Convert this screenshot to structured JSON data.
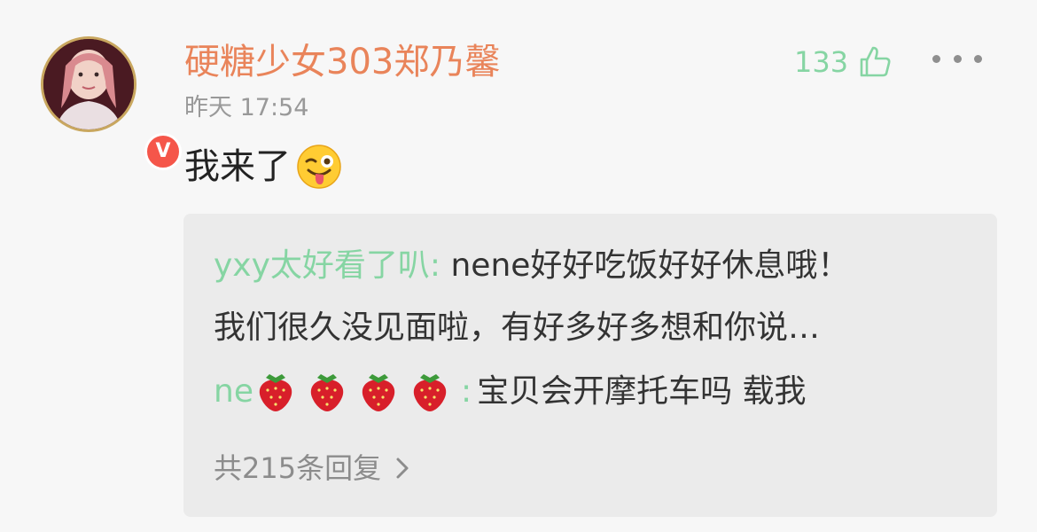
{
  "comment": {
    "username": "硬糖少女303郑乃馨",
    "time": "昨天 17:54",
    "like_count": "133",
    "text": "我来了",
    "verified_badge": "V"
  },
  "replies": [
    {
      "user": "yxy太好看了叭:",
      "text": " nene好好吃饭好好休息哦！"
    },
    {
      "user": "",
      "text": "我们很久没见面啦，有好多好多想和你说…"
    },
    {
      "user": "ne",
      "user_suffix_emoji": "strawberry-x4",
      "colon": ":",
      "text": "宝贝会开摩托车吗 载我"
    }
  ],
  "view_more": "共215条回复",
  "icons": {
    "like": "thumbs-up-icon",
    "more": "more-horizontal-icon",
    "emoji_main": "winking-tongue-emoji",
    "reply_emoji": "strawberry-emoji",
    "chevron": "chevron-right-icon"
  },
  "colors": {
    "username": "#e9845a",
    "accent_green": "#86d5a3",
    "badge": "#f5564a",
    "avatar_ring": "#c9a75f"
  }
}
